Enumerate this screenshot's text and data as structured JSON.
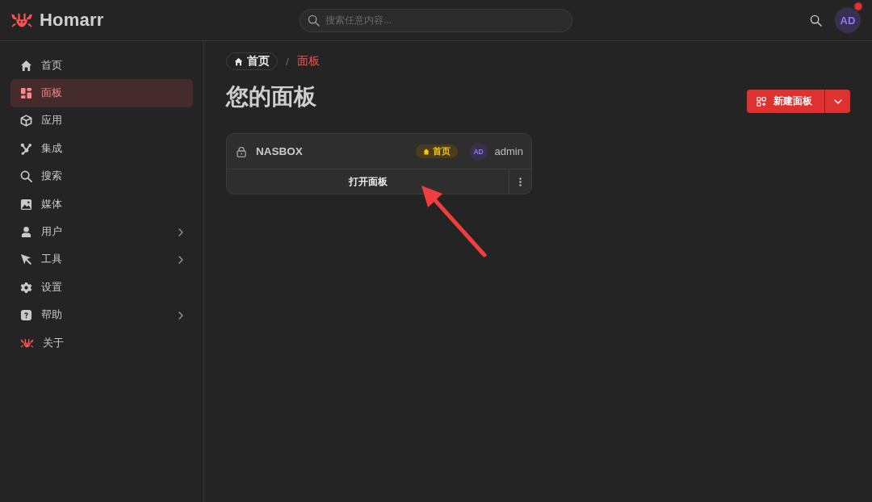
{
  "header": {
    "logo_text": "Homarr",
    "search": {
      "placeholder": "搜索任意内容..."
    },
    "avatar": {
      "initials": "AD",
      "notification": true
    }
  },
  "sidebar": {
    "items": [
      {
        "label": "首页",
        "selected": false,
        "expandable": false
      },
      {
        "label": "面板",
        "selected": true,
        "expandable": false
      },
      {
        "label": "应用",
        "selected": false,
        "expandable": false
      },
      {
        "label": "集成",
        "selected": false,
        "expandable": false
      },
      {
        "label": "搜索",
        "selected": false,
        "expandable": false
      },
      {
        "label": "媒体",
        "selected": false,
        "expandable": false
      },
      {
        "label": "用户",
        "selected": false,
        "expandable": true
      },
      {
        "label": "工具",
        "selected": false,
        "expandable": true
      },
      {
        "label": "设置",
        "selected": false,
        "expandable": false
      },
      {
        "label": "帮助",
        "selected": false,
        "expandable": true
      },
      {
        "label": "关于",
        "selected": false,
        "expandable": false
      }
    ]
  },
  "breadcrumb": [
    {
      "label": "首页",
      "kind": "home"
    },
    {
      "label": "/",
      "kind": "separator"
    },
    {
      "label": "面板",
      "kind": "current"
    }
  ],
  "title": "您的面板",
  "new_button": {
    "label": "新建面板"
  },
  "boards": [
    {
      "name": "NASBOX",
      "locked": true,
      "badge": "首页",
      "owner_initials": "AD",
      "owner": "admin",
      "open_label": "打开面板"
    }
  ]
}
